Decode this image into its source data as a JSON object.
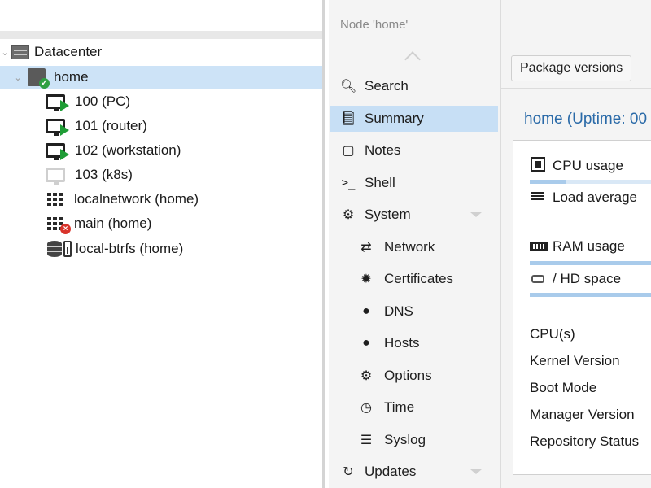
{
  "tree": {
    "items": [
      {
        "label": "Datacenter",
        "icon": "datacenter-icon"
      },
      {
        "label": "home",
        "icon": "node-online-icon",
        "selected": true
      },
      {
        "label": "100 (PC)",
        "icon": "vm-running-icon"
      },
      {
        "label": "101 (router)",
        "icon": "vm-running-icon"
      },
      {
        "label": "102 (workstation)",
        "icon": "vm-running-icon"
      },
      {
        "label": "103 (k8s)",
        "icon": "vm-stopped-icon"
      },
      {
        "label": "localnetwork (home)",
        "icon": "network-icon"
      },
      {
        "label": "main (home)",
        "icon": "network-error-icon"
      },
      {
        "label": "local-btrfs (home)",
        "icon": "storage-icon"
      }
    ]
  },
  "nav": {
    "title": "Node 'home'",
    "items": [
      {
        "label": "Search",
        "icon": "search-icon"
      },
      {
        "label": "Summary",
        "icon": "book-icon",
        "selected": true
      },
      {
        "label": "Notes",
        "icon": "notes-icon"
      },
      {
        "label": "Shell",
        "icon": "terminal-icon"
      },
      {
        "label": "System",
        "icon": "gears-icon"
      },
      {
        "label": "Network",
        "icon": "exchange-icon"
      },
      {
        "label": "Certificates",
        "icon": "certificate-icon"
      },
      {
        "label": "DNS",
        "icon": "globe-icon"
      },
      {
        "label": "Hosts",
        "icon": "globe-icon"
      },
      {
        "label": "Options",
        "icon": "gear-icon"
      },
      {
        "label": "Time",
        "icon": "clock-icon"
      },
      {
        "label": "Syslog",
        "icon": "list-icon"
      },
      {
        "label": "Updates",
        "icon": "refresh-icon"
      }
    ]
  },
  "toolbar": {
    "package_versions_label": "Package versions"
  },
  "summary": {
    "title": "home (Uptime: 00",
    "stats": [
      {
        "label": "CPU usage",
        "icon": "cpu-icon"
      },
      {
        "label": "Load average",
        "icon": "load-icon"
      },
      {
        "label": "RAM usage",
        "icon": "memory-icon"
      },
      {
        "label": "/ HD space",
        "icon": "hdd-icon"
      }
    ],
    "info_labels": [
      "CPU(s)",
      "Kernel Version",
      "Boot Mode",
      "Manager Version",
      "Repository Status"
    ]
  },
  "colors": {
    "selection": "#cde3f7",
    "nav_selection": "#c7dff5",
    "title_blue": "#2a6aa8",
    "running_green": "#1f9d36",
    "error_red": "#d9342b"
  }
}
